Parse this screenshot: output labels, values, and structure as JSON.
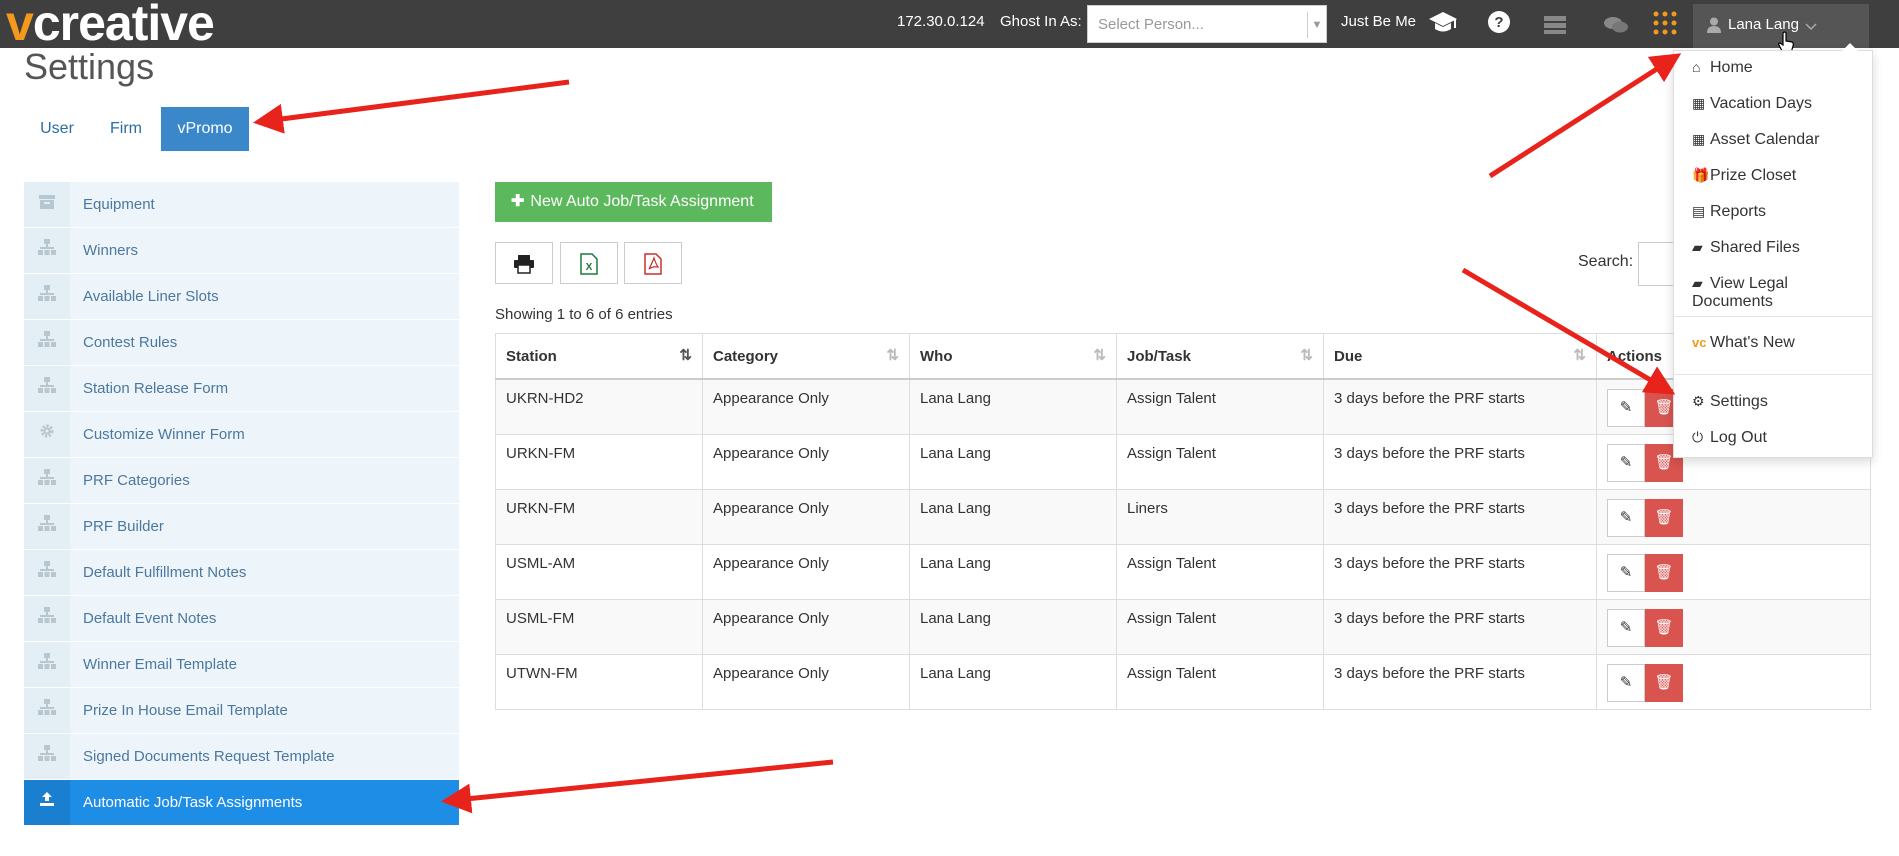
{
  "topbar": {
    "logo_prefix": "v",
    "logo_rest": "creative",
    "ip": "172.30.0.124",
    "ghost_label": "Ghost In As:",
    "ghost_placeholder": "Select Person...",
    "just_be_me": "Just Be Me",
    "user_name": "Lana Lang",
    "icons": [
      "graduation-cap-icon",
      "help-icon",
      "server-icon",
      "chat-icon",
      "apps-grid-icon",
      "user-icon",
      "chevron-down-icon"
    ]
  },
  "page": {
    "title": "Settings"
  },
  "tabs": [
    {
      "label": "User"
    },
    {
      "label": "Firm"
    },
    {
      "label": "vPromo"
    }
  ],
  "sidebar": {
    "items": [
      {
        "label": "Equipment",
        "icon": "box-icon"
      },
      {
        "label": "Winners",
        "icon": "sitemap-icon"
      },
      {
        "label": "Available Liner Slots",
        "icon": "sitemap-icon"
      },
      {
        "label": "Contest Rules",
        "icon": "sitemap-icon"
      },
      {
        "label": "Station Release Form",
        "icon": "sitemap-icon"
      },
      {
        "label": "Customize Winner Form",
        "icon": "gear-icon"
      },
      {
        "label": "PRF Categories",
        "icon": "sitemap-icon"
      },
      {
        "label": "PRF Builder",
        "icon": "sitemap-icon"
      },
      {
        "label": "Default Fulfillment Notes",
        "icon": "sitemap-icon"
      },
      {
        "label": "Default Event Notes",
        "icon": "sitemap-icon"
      },
      {
        "label": "Winner Email Template",
        "icon": "sitemap-icon"
      },
      {
        "label": "Prize In House Email Template",
        "icon": "sitemap-icon"
      },
      {
        "label": "Signed Documents Request Template",
        "icon": "sitemap-icon"
      },
      {
        "label": "Automatic Job/Task Assignments",
        "icon": "upload-icon"
      }
    ]
  },
  "main": {
    "new_button": "New Auto Job/Task Assignment",
    "search_label": "Search:",
    "info": "Showing 1 to 6 of 6 entries",
    "columns": [
      "Station",
      "Category",
      "Who",
      "Job/Task",
      "Due",
      "Actions"
    ],
    "rows": [
      [
        "UKRN-HD2",
        "Appearance Only",
        "Lana Lang",
        "Assign Talent",
        "3 days before the PRF starts"
      ],
      [
        "URKN-FM",
        "Appearance Only",
        "Lana Lang",
        "Assign Talent",
        "3 days before the PRF starts"
      ],
      [
        "URKN-FM",
        "Appearance Only",
        "Lana Lang",
        "Liners",
        "3 days before the PRF starts"
      ],
      [
        "USML-AM",
        "Appearance Only",
        "Lana Lang",
        "Assign Talent",
        "3 days before the PRF starts"
      ],
      [
        "USML-FM",
        "Appearance Only",
        "Lana Lang",
        "Assign Talent",
        "3 days before the PRF starts"
      ],
      [
        "UTWN-FM",
        "Appearance Only",
        "Lana Lang",
        "Assign Talent",
        "3 days before the PRF starts"
      ]
    ]
  },
  "dropdown": {
    "items": [
      {
        "label": "Home",
        "icon": "home-icon"
      },
      {
        "label": "Vacation Days",
        "icon": "calendar-icon"
      },
      {
        "label": "Asset Calendar",
        "icon": "calendar-icon"
      },
      {
        "label": "Prize Closet",
        "icon": "gift-icon"
      },
      {
        "label": "Reports",
        "icon": "file-icon"
      },
      {
        "label": "Shared Files",
        "icon": "folder-open-icon"
      },
      {
        "label": "View Legal Documents",
        "icon": "folder-open-icon"
      },
      {
        "label": "What's New",
        "icon": "vc-logo-icon"
      },
      {
        "label": "Settings",
        "icon": "gear-icon"
      },
      {
        "label": "Log Out",
        "icon": "power-icon"
      }
    ]
  },
  "colors": {
    "topbar": "#3f3f3f",
    "logo_accent": "#f39a1c",
    "tab_active": "#3a87c9",
    "sidebar_active": "#1e8de6",
    "new_button": "#5cb85c",
    "delete_button": "#d9534f",
    "annotation_arrow": "#e8231b"
  }
}
